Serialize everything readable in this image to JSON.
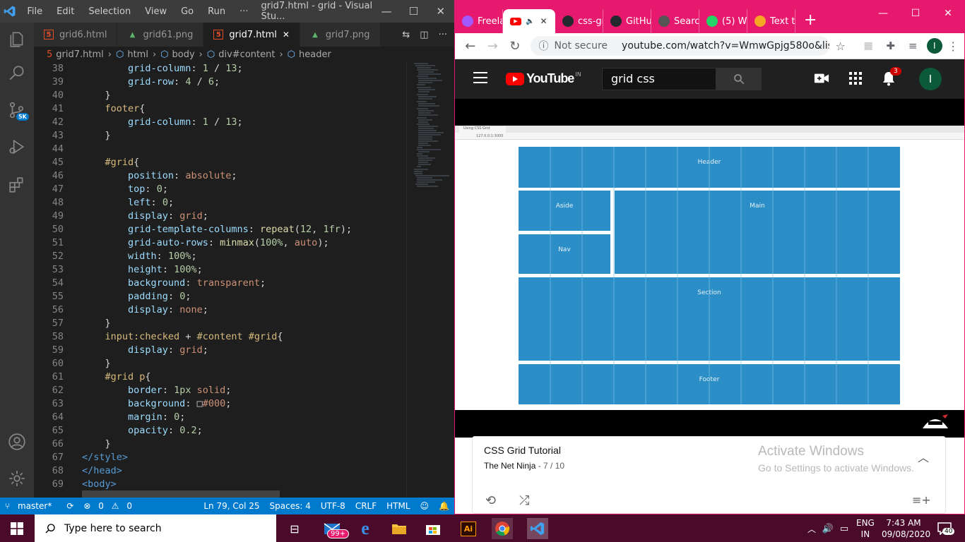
{
  "vscode": {
    "menu": [
      "File",
      "Edit",
      "Selection",
      "View",
      "Go",
      "Run",
      "···"
    ],
    "window_title": "grid7.html - grid - Visual Stu...",
    "tabs": [
      {
        "label": "grid6.html",
        "icon": "html5-icon",
        "active": false
      },
      {
        "label": "grid61.png",
        "icon": "image-icon",
        "active": false
      },
      {
        "label": "grid7.html",
        "icon": "html5-icon",
        "active": true
      },
      {
        "label": "grid7.png",
        "icon": "image-icon",
        "active": false
      }
    ],
    "breadcrumb": [
      "grid7.html",
      "html",
      "body",
      "div#content",
      "header"
    ],
    "status": {
      "branch": "master*",
      "errors": "0",
      "warnings": "0",
      "position": "Ln 79, Col 25",
      "spaces": "Spaces: 4",
      "encoding": "UTF-8",
      "eol": "CRLF",
      "language": "HTML"
    },
    "accounts_badge": "5K",
    "code_lines": [
      {
        "n": "38",
        "segs": [
          [
            "        ",
            ""
          ],
          [
            "grid-column",
            "p"
          ],
          [
            ": ",
            ""
          ],
          [
            "1",
            "n"
          ],
          [
            " / ",
            ""
          ],
          [
            "13",
            "n"
          ],
          [
            ";",
            ""
          ]
        ]
      },
      {
        "n": "39",
        "segs": [
          [
            "        ",
            ""
          ],
          [
            "grid-row",
            "p"
          ],
          [
            ": ",
            ""
          ],
          [
            "4",
            "n"
          ],
          [
            " / ",
            ""
          ],
          [
            "6",
            "n"
          ],
          [
            ";",
            ""
          ]
        ]
      },
      {
        "n": "40",
        "segs": [
          [
            "    }",
            ""
          ]
        ]
      },
      {
        "n": "41",
        "segs": [
          [
            "    ",
            ""
          ],
          [
            "footer",
            "s"
          ],
          [
            "{",
            ""
          ]
        ]
      },
      {
        "n": "42",
        "segs": [
          [
            "        ",
            ""
          ],
          [
            "grid-column",
            "p"
          ],
          [
            ": ",
            ""
          ],
          [
            "1",
            "n"
          ],
          [
            " / ",
            ""
          ],
          [
            "13",
            "n"
          ],
          [
            ";",
            ""
          ]
        ]
      },
      {
        "n": "43",
        "segs": [
          [
            "    }",
            ""
          ]
        ]
      },
      {
        "n": "44",
        "segs": [
          [
            "",
            ""
          ]
        ]
      },
      {
        "n": "45",
        "segs": [
          [
            "    ",
            ""
          ],
          [
            "#grid",
            "s"
          ],
          [
            "{",
            ""
          ]
        ]
      },
      {
        "n": "46",
        "segs": [
          [
            "        ",
            ""
          ],
          [
            "position",
            "p"
          ],
          [
            ": ",
            ""
          ],
          [
            "absolute",
            "v"
          ],
          [
            ";",
            ""
          ]
        ]
      },
      {
        "n": "47",
        "segs": [
          [
            "        ",
            ""
          ],
          [
            "top",
            "p"
          ],
          [
            ": ",
            ""
          ],
          [
            "0",
            "n"
          ],
          [
            ";",
            ""
          ]
        ]
      },
      {
        "n": "48",
        "segs": [
          [
            "        ",
            ""
          ],
          [
            "left",
            "p"
          ],
          [
            ": ",
            ""
          ],
          [
            "0",
            "n"
          ],
          [
            ";",
            ""
          ]
        ]
      },
      {
        "n": "49",
        "segs": [
          [
            "        ",
            ""
          ],
          [
            "display",
            "p"
          ],
          [
            ": ",
            ""
          ],
          [
            "grid",
            "v"
          ],
          [
            ";",
            ""
          ]
        ]
      },
      {
        "n": "50",
        "segs": [
          [
            "        ",
            ""
          ],
          [
            "grid-template-columns",
            "p"
          ],
          [
            ": ",
            ""
          ],
          [
            "repeat",
            "f"
          ],
          [
            "(",
            ""
          ],
          [
            "12",
            "n"
          ],
          [
            ", ",
            ""
          ],
          [
            "1fr",
            "n"
          ],
          [
            ");",
            ""
          ]
        ]
      },
      {
        "n": "51",
        "segs": [
          [
            "        ",
            ""
          ],
          [
            "grid-auto-rows",
            "p"
          ],
          [
            ": ",
            ""
          ],
          [
            "minmax",
            "f"
          ],
          [
            "(",
            ""
          ],
          [
            "100%",
            "n"
          ],
          [
            ", ",
            ""
          ],
          [
            "auto",
            "v"
          ],
          [
            ");",
            ""
          ]
        ]
      },
      {
        "n": "52",
        "segs": [
          [
            "        ",
            ""
          ],
          [
            "width",
            "p"
          ],
          [
            ": ",
            ""
          ],
          [
            "100%",
            "n"
          ],
          [
            ";",
            ""
          ]
        ]
      },
      {
        "n": "53",
        "segs": [
          [
            "        ",
            ""
          ],
          [
            "height",
            "p"
          ],
          [
            ": ",
            ""
          ],
          [
            "100%",
            "n"
          ],
          [
            ";",
            ""
          ]
        ]
      },
      {
        "n": "54",
        "segs": [
          [
            "        ",
            ""
          ],
          [
            "background",
            "p"
          ],
          [
            ": ",
            ""
          ],
          [
            "transparent",
            "v"
          ],
          [
            ";",
            ""
          ]
        ]
      },
      {
        "n": "55",
        "segs": [
          [
            "        ",
            ""
          ],
          [
            "padding",
            "p"
          ],
          [
            ": ",
            ""
          ],
          [
            "0",
            "n"
          ],
          [
            ";",
            ""
          ]
        ]
      },
      {
        "n": "56",
        "segs": [
          [
            "        ",
            ""
          ],
          [
            "display",
            "p"
          ],
          [
            ": ",
            ""
          ],
          [
            "none",
            "v"
          ],
          [
            ";",
            ""
          ]
        ]
      },
      {
        "n": "57",
        "segs": [
          [
            "    }",
            ""
          ]
        ]
      },
      {
        "n": "58",
        "segs": [
          [
            "    ",
            ""
          ],
          [
            "input:checked",
            "s"
          ],
          [
            " + ",
            ""
          ],
          [
            "#content",
            "s"
          ],
          [
            " ",
            ""
          ],
          [
            "#grid",
            "s"
          ],
          [
            "{",
            ""
          ]
        ]
      },
      {
        "n": "59",
        "segs": [
          [
            "        ",
            ""
          ],
          [
            "display",
            "p"
          ],
          [
            ": ",
            ""
          ],
          [
            "grid",
            "v"
          ],
          [
            ";",
            ""
          ]
        ]
      },
      {
        "n": "60",
        "segs": [
          [
            "    }",
            ""
          ]
        ]
      },
      {
        "n": "61",
        "segs": [
          [
            "    ",
            ""
          ],
          [
            "#grid p",
            "s"
          ],
          [
            "{",
            ""
          ]
        ]
      },
      {
        "n": "62",
        "segs": [
          [
            "        ",
            ""
          ],
          [
            "border",
            "p"
          ],
          [
            ": ",
            ""
          ],
          [
            "1px",
            "n"
          ],
          [
            " ",
            ""
          ],
          [
            "solid",
            "v"
          ],
          [
            ";",
            ""
          ]
        ]
      },
      {
        "n": "63",
        "segs": [
          [
            "        ",
            ""
          ],
          [
            "background",
            "p"
          ],
          [
            ": ",
            ""
          ],
          [
            "□",
            ""
          ],
          [
            "#000",
            "v"
          ],
          [
            ";",
            ""
          ]
        ]
      },
      {
        "n": "64",
        "segs": [
          [
            "        ",
            ""
          ],
          [
            "margin",
            "p"
          ],
          [
            ": ",
            ""
          ],
          [
            "0",
            "n"
          ],
          [
            ";",
            ""
          ]
        ]
      },
      {
        "n": "65",
        "segs": [
          [
            "        ",
            ""
          ],
          [
            "opacity",
            "p"
          ],
          [
            ": ",
            ""
          ],
          [
            "0.2",
            "n"
          ],
          [
            ";",
            ""
          ]
        ]
      },
      {
        "n": "66",
        "segs": [
          [
            "    }",
            ""
          ]
        ]
      },
      {
        "n": "67",
        "segs": [
          [
            "</",
            "t"
          ],
          [
            "style",
            "t"
          ],
          [
            ">",
            "t"
          ]
        ]
      },
      {
        "n": "68",
        "segs": [
          [
            "</",
            "t"
          ],
          [
            "head",
            "t"
          ],
          [
            ">",
            "t"
          ]
        ]
      },
      {
        "n": "69",
        "segs": [
          [
            "<",
            "t"
          ],
          [
            "body",
            "t"
          ],
          [
            ">",
            "t"
          ]
        ]
      }
    ]
  },
  "chrome": {
    "tabs": [
      {
        "label": "Freela",
        "favicon": "figma-icon",
        "color": "#a259ff"
      },
      {
        "label": "",
        "favicon": "youtube-icon",
        "color": "#ff0000",
        "active": true
      },
      {
        "label": "css-gr",
        "favicon": "github-icon",
        "color": "#24292e"
      },
      {
        "label": "GitHu",
        "favicon": "github-icon",
        "color": "#24292e"
      },
      {
        "label": "Searc",
        "favicon": "search-icon",
        "color": "#555"
      },
      {
        "label": "(5) Wl",
        "favicon": "whatsapp-icon",
        "color": "#25d366"
      },
      {
        "label": "Text tı",
        "favicon": "text-icon",
        "color": "#f5a623"
      }
    ],
    "not_secure": "Not secure",
    "url": "youtube.com/watch?v=WmwGpjg580o&list=...",
    "profile_initial": "I"
  },
  "youtube": {
    "logo": "YouTube",
    "country": "IN",
    "search_value": "grid css",
    "notif_count": "3",
    "avatar_initial": "I",
    "video_grid_labels": {
      "header": "Header",
      "aside": "Aside",
      "main": "Main",
      "nav": "Nav",
      "section": "Section",
      "footer": "Footer"
    },
    "inner_tab_title": "Using CSS Grid",
    "inner_url": "127.0.0.1:3000",
    "playlist_title": "CSS Grid Tutorial",
    "playlist_author": "The Net Ninja",
    "playlist_position": "- 7 / 10",
    "watermark_title": "Activate Windows",
    "watermark_sub": "Go to Settings to activate Windows."
  },
  "taskbar": {
    "search_placeholder": "Type here to search",
    "mail_badge": "99+",
    "lang": "ENG",
    "region": "IN",
    "time": "7:43 AM",
    "date": "09/08/2020",
    "notif_count": "40"
  },
  "colors": {
    "vscode_status": "#007acc",
    "chrome_frame": "#e6196e",
    "taskbar": "#4a0a2a",
    "grid_cell": "#2b8ec6"
  }
}
